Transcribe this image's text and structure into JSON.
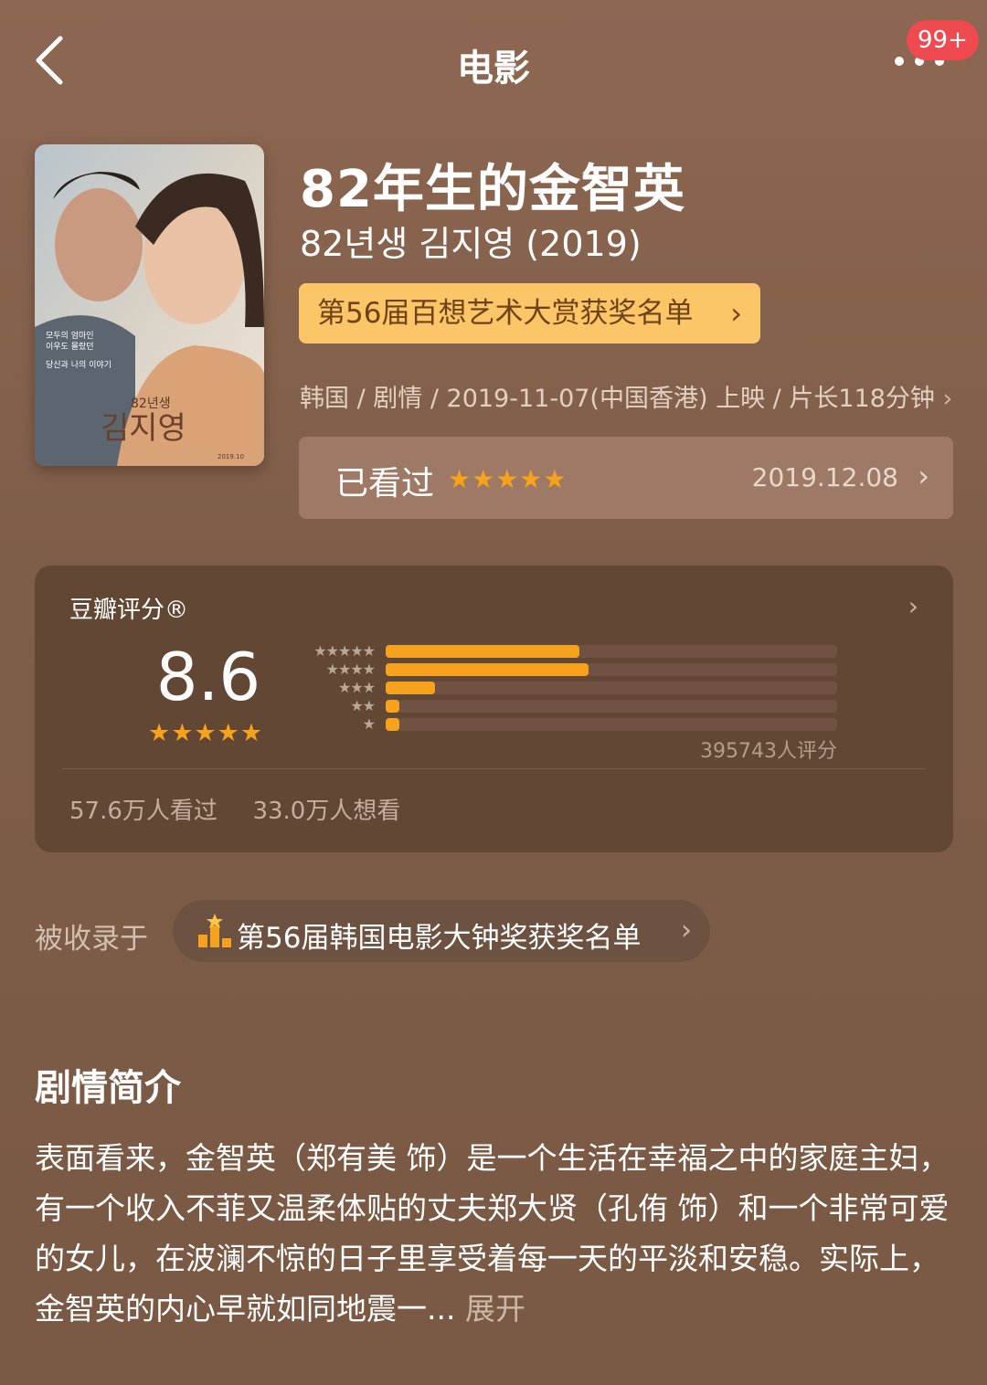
{
  "nav": {
    "title": "电影",
    "badge": "99+"
  },
  "movie": {
    "title": "82年生的金智英",
    "original_title": "82년생 김지영 (2019)",
    "award_link": "第56届百想艺术大赏获奖名单",
    "meta": "韩国 / 剧情 / 2019-11-07(中国香港) 上映 / 片长118分钟",
    "poster": {
      "text_line1": "82년생",
      "text_line2": "김지영",
      "tag1": "모두의 엄마인",
      "tag2": "이우도 몰랐던",
      "tag3": "당신과 나의 이야기",
      "date": "2019.10"
    }
  },
  "watched": {
    "label": "已看过",
    "stars": "★★★★★",
    "date": "2019.12.08"
  },
  "rating": {
    "title": "豆瓣评分®",
    "score": "8.6",
    "score_stars": "★★★★★",
    "score_value": 4.3,
    "distribution": [
      {
        "stars": "★★★★★",
        "fraction": 0.43
      },
      {
        "stars": "★★★★",
        "fraction": 0.45
      },
      {
        "stars": "★★★",
        "fraction": 0.11
      },
      {
        "stars": "★★",
        "fraction": 0.03
      },
      {
        "stars": "★",
        "fraction": 0.03
      }
    ],
    "count": "395743人评分",
    "watched_count": "57.6万人看过",
    "wish_count": "33.0万人想看"
  },
  "collected": {
    "label": "被收录于",
    "list_name": "第56届韩国电影大钟奖获奖名单"
  },
  "synopsis": {
    "title": "剧情简介",
    "body": "表面看来，金智英（郑有美 饰）是一个生活在幸福之中的家庭主妇，有一个收入不菲又温柔体贴的丈夫郑大贤（孔侑 饰）和一个非常可爱的女儿，在波澜不惊的日子里享受着每一天的平淡和安稳。实际上，金智英的内心早就如同地震一...",
    "expand": "展开"
  },
  "colors": {
    "background": "#7f5e49",
    "accent_star": "#f6a21c",
    "award_button": "#fbc568",
    "badge": "#ee4a4f"
  }
}
